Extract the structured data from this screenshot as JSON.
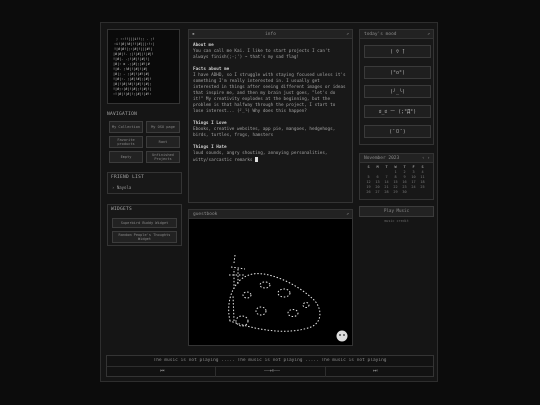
{
  "navigation": {
    "title": "NAVIGATION",
    "buttons": [
      "My Collection",
      "My OSU page",
      "Favorite products",
      "Rant",
      "Empty",
      "Unfinished Projects"
    ]
  },
  "friend_list": {
    "title": "FRIEND LIST",
    "items": [
      "Nayola"
    ]
  },
  "widgets": {
    "title": "WIDGETS",
    "items": [
      "Superbird Buddy Widget",
      "Random People's Thoughts Widget"
    ]
  },
  "info": {
    "header": "info",
    "about_title": "About me",
    "about_text": "You can call me Kai. I like to start projects I can't always finish(;-;') ~ that's my sad flag!",
    "facts_title": "Facts about me",
    "facts_text": "I have ADHD, so I struggle with staying focused unless it's something I'm really interested in. I usually get interested in things after seeing different images or ideas that inspire me, and then my brain just goes, \"let's do it!\" My creativity explodes at the beginning, but the problem is that halfway through the project, I start to lose interest... (╯_╰) Why does this happen?",
    "love_title": "Things I Love",
    "love_text": "Ebooks, creative websites, app pie, mangoes, hedgehogs, birds, turtles, frogs, hamsters",
    "hate_title": "Things I Hate",
    "hate_text": "loud sounds, angry shouting, annoying personalities, witty/sarcastic remarks"
  },
  "guestbook": {
    "header": "guestbook"
  },
  "mood": {
    "header": "today's mood",
    "items": [
      "( ̄▽ ̄)",
      "(°o°)",
      "(╯_╰)",
      "ಠ_ಠ ー (;°Д°)",
      "(¯ㅁ¯)"
    ]
  },
  "calendar": {
    "month": "November 2023",
    "nav_prev": "‹",
    "nav_next": "›",
    "weekdays": [
      "S",
      "M",
      "T",
      "W",
      "T",
      "F",
      "S"
    ],
    "weeks": [
      [
        "",
        "",
        "",
        "1",
        "2",
        "3",
        "4"
      ],
      [
        "5",
        "6",
        "7",
        "8",
        "9",
        "10",
        "11"
      ],
      [
        "12",
        "13",
        "14",
        "15",
        "16",
        "17",
        "18"
      ],
      [
        "19",
        "20",
        "21",
        "22",
        "23",
        "24",
        "25"
      ],
      [
        "26",
        "27",
        "28",
        "29",
        "30",
        "",
        ""
      ]
    ]
  },
  "music": {
    "play_label": "Play Music",
    "credit": "music credit",
    "marquee": "The music is not playing ..... The music is not playing ..... The music is not playing",
    "prev": "⏮",
    "center": "——⏯——",
    "next": "⏭"
  }
}
